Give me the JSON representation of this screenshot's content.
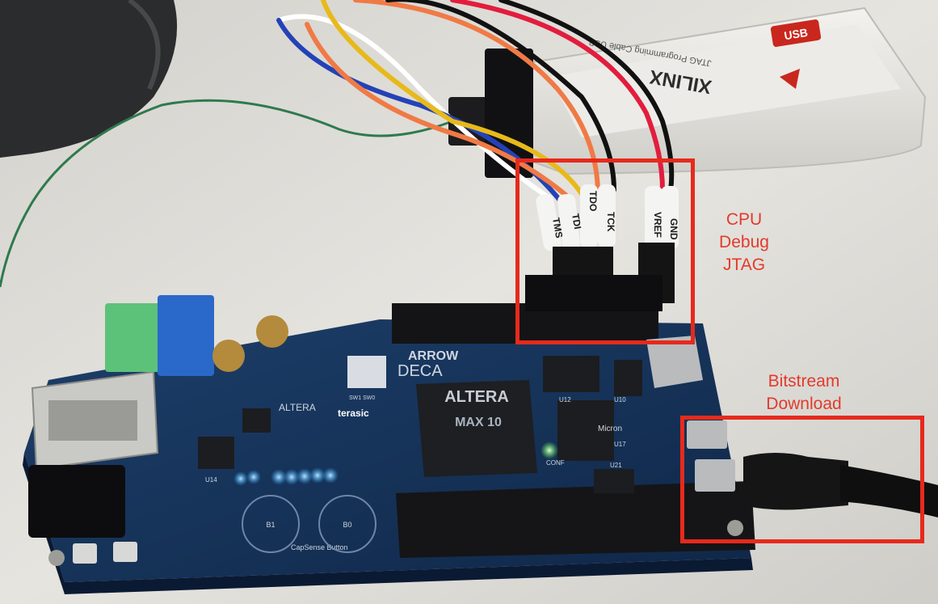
{
  "photo": {
    "board": {
      "brand": "DECA",
      "silk_brand": "terasic",
      "vendor_logo": "ALTERA",
      "fpga_text": "MAX 10",
      "maker_logo": "ARROW",
      "capsense_label": "CapSense Button",
      "pad_b1": "B1",
      "pad_b0": "B0",
      "conf_label": "CONF",
      "chip_u12": "U12",
      "chip_u10": "U10",
      "chip_u21": "U21",
      "chip_u17": "U17",
      "chip_u14": "U14",
      "sw_label": "SW1 SW0",
      "memory_brand": "Micron"
    },
    "programmer": {
      "brand": "XILINX",
      "label": "JTAG Programming Cable USB",
      "usb_badge": "USB"
    },
    "wire_labels": [
      "TMS",
      "TDI",
      "TDO",
      "TCK",
      "VREF",
      "GND"
    ],
    "colors": {
      "callout_red": "#e62a1c",
      "led_blue": "#2aa4ff",
      "led_green": "#55ff40",
      "pcb_blue": "#17355c"
    }
  },
  "annotations": {
    "jtag_label": "CPU\nDebug\nJTAG",
    "bitstream_label": "Bitstream\nDownload"
  }
}
